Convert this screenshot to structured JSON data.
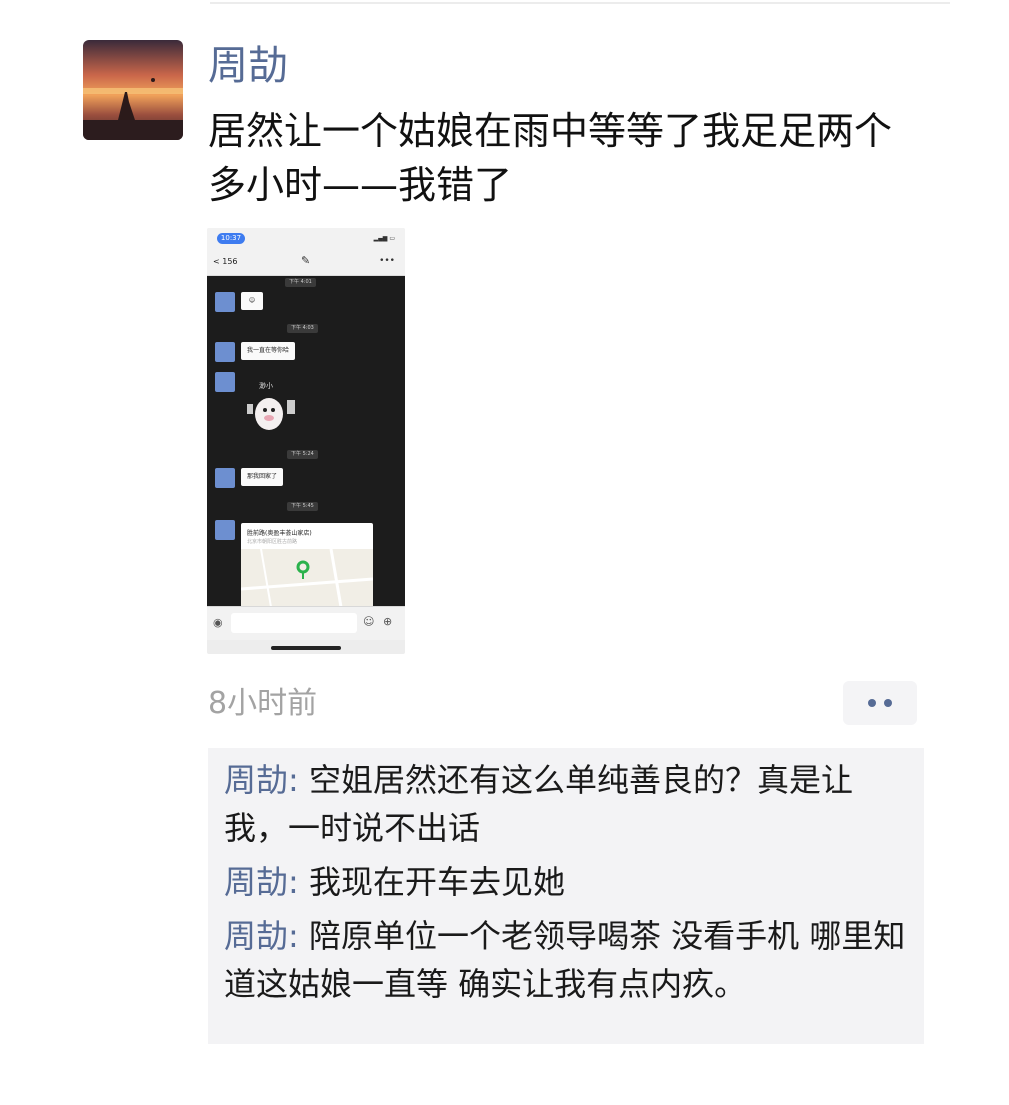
{
  "post": {
    "author": "周劼",
    "text": "居然让一个姑娘在雨中等等了我足足两个多小时——我错了",
    "time": "8小时前"
  },
  "screenshot": {
    "status_time": "10:37",
    "back_label": "< 156",
    "timestamps": [
      "下午 4:01",
      "下午 4:03",
      "下午 5:24",
      "下午 5:45"
    ],
    "bubble_1": "我一直在等你哈",
    "bubble_2": "那我回家了",
    "map_title": "胜前路(奥盈丰荟山家店)",
    "map_subtitle": "北京市朝阳区胜古前路",
    "sticker_text": "渺小"
  },
  "comments": [
    {
      "author": "周劼",
      "text": "空姐居然还有这么单纯善良的？真是让我，一时说不出话"
    },
    {
      "author": "周劼",
      "text": "我现在开车去见她"
    },
    {
      "author": "周劼",
      "text": "陪原单位一个老领导喝茶  没看手机  哪里知道这姑娘一直等    确实让我有点内疚。"
    }
  ],
  "colors": {
    "name_link": "#566b95",
    "timestamp_gray": "#a3a3a3",
    "comment_bg": "#f3f3f5"
  },
  "icons": {
    "more": "ellipsis-icon",
    "voice": "voice-icon",
    "emoji": "emoji-icon",
    "plus": "plus-icon"
  }
}
